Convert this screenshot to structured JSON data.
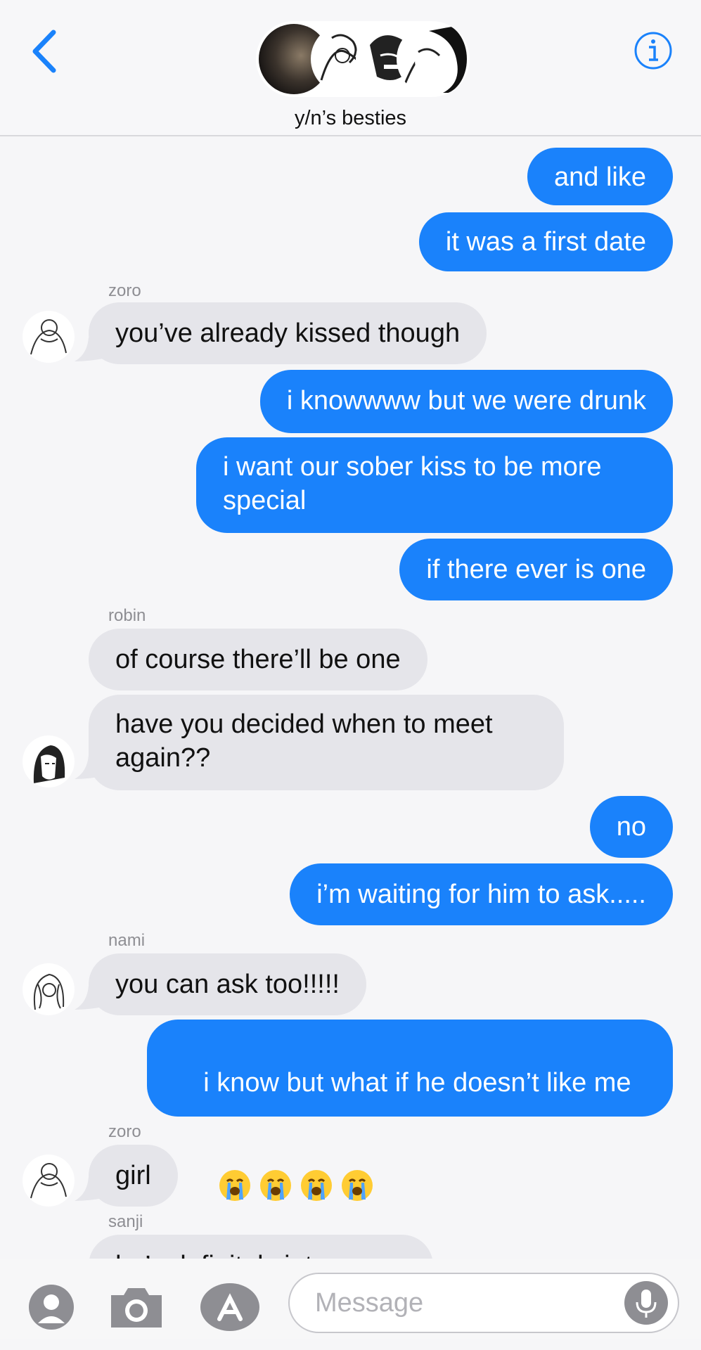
{
  "header": {
    "group_name": "y/n’s besties",
    "accent_color": "#1a82fb"
  },
  "messages": [
    {
      "dir": "out",
      "text": "and like"
    },
    {
      "dir": "out",
      "text": "it was a first date"
    },
    {
      "sender": "zoro",
      "dir": "in",
      "text": "you’ve already kissed though"
    },
    {
      "dir": "out",
      "text": "i knowwww but we were drunk"
    },
    {
      "dir": "out",
      "text": "i want our sober kiss to be more special"
    },
    {
      "dir": "out",
      "text": "if there ever is one"
    },
    {
      "sender": "robin",
      "dir": "in",
      "text": "of course there’ll be one"
    },
    {
      "dir": "in",
      "text": "have you decided when to meet again??"
    },
    {
      "dir": "out",
      "text": "no"
    },
    {
      "dir": "out",
      "text": "i’m waiting for him to ask....."
    },
    {
      "sender": "nami",
      "dir": "in",
      "text": "you can ask too!!!!!"
    },
    {
      "dir": "out",
      "text": "i know but what if he doesn’t like me",
      "emoji": [
        "loudly-crying-face",
        "loudly-crying-face",
        "loudly-crying-face",
        "loudly-crying-face"
      ]
    },
    {
      "sender": "zoro",
      "dir": "in",
      "text": "girl"
    },
    {
      "sender": "sanji",
      "dir": "in",
      "text": "he’s definitely into you"
    }
  ],
  "senders": [
    "zoro",
    "robin",
    "nami",
    "zoro",
    "sanji"
  ],
  "composer": {
    "placeholder": "Message"
  },
  "icons": [
    "back-chevron-icon",
    "info-icon",
    "contact-icon",
    "camera-icon",
    "app-store-icon",
    "microphone-icon"
  ]
}
